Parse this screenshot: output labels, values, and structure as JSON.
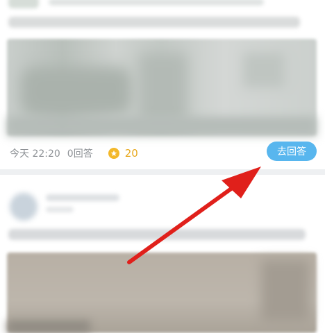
{
  "feed": {
    "items": [
      {
        "time": "今天 22:20",
        "answers": "0回答",
        "points": "20",
        "action_label": "去回答"
      }
    ]
  },
  "colors": {
    "accent": "#58b6ee",
    "coin": "#f3b82a",
    "points_text": "#e8a91e",
    "arrow": "#e0201b"
  },
  "icons": {
    "coin": "coin-icon",
    "arrow": "annotation-arrow"
  }
}
